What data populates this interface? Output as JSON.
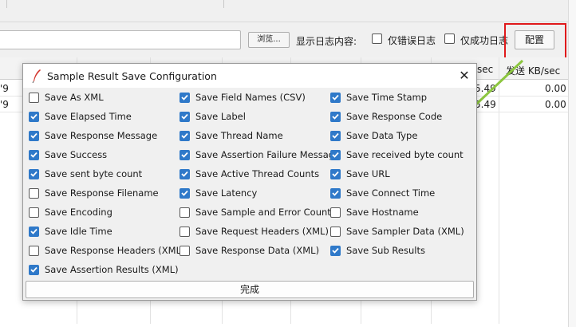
{
  "toolbar": {
    "browse_label": "浏览...",
    "log_content_label": "显示日志内容:",
    "errors_only_label": "仅错误日志",
    "errors_only_checked": false,
    "success_only_label": "仅成功日志",
    "success_only_checked": false,
    "config_label": "配置"
  },
  "table": {
    "header_sec": "sec",
    "header_sent": "发送 KB/sec",
    "rows": [
      {
        "first": "'9",
        "rate": "5.49",
        "sent": "0.00"
      },
      {
        "first": "'9",
        "rate": "5.49",
        "sent": "0.00"
      }
    ]
  },
  "dialog": {
    "title": "Sample Result Save Configuration",
    "icon": "feather-icon",
    "close_icon": "close-icon",
    "done_label": "完成",
    "columns": [
      [
        {
          "label": "Save As XML",
          "checked": false
        },
        {
          "label": "Save Elapsed Time",
          "checked": true
        },
        {
          "label": "Save Response Message",
          "checked": true
        },
        {
          "label": "Save Success",
          "checked": true
        },
        {
          "label": "Save sent byte count",
          "checked": true
        },
        {
          "label": "Save Response Filename",
          "checked": false
        },
        {
          "label": "Save Encoding",
          "checked": false
        },
        {
          "label": "Save Idle Time",
          "checked": true
        },
        {
          "label": "Save Response Headers (XML)",
          "checked": false
        },
        {
          "label": "Save Assertion Results (XML)",
          "checked": true
        }
      ],
      [
        {
          "label": "Save Field Names (CSV)",
          "checked": true
        },
        {
          "label": "Save Label",
          "checked": true
        },
        {
          "label": "Save Thread Name",
          "checked": true
        },
        {
          "label": "Save Assertion Failure Message",
          "checked": true
        },
        {
          "label": "Save Active Thread Counts",
          "checked": true
        },
        {
          "label": "Save Latency",
          "checked": true
        },
        {
          "label": "Save Sample and Error Counts",
          "checked": false
        },
        {
          "label": "Save Request Headers (XML)",
          "checked": false
        },
        {
          "label": "Save Response Data (XML)",
          "checked": false
        }
      ],
      [
        {
          "label": "Save Time Stamp",
          "checked": true
        },
        {
          "label": "Save Response Code",
          "checked": true
        },
        {
          "label": "Save Data Type",
          "checked": true
        },
        {
          "label": "Save received byte count",
          "checked": true
        },
        {
          "label": "Save URL",
          "checked": true
        },
        {
          "label": "Save Connect Time",
          "checked": true
        },
        {
          "label": "Save Hostname",
          "checked": false
        },
        {
          "label": "Save Sampler Data (XML)",
          "checked": false
        },
        {
          "label": "Save Sub Results",
          "checked": true
        }
      ]
    ]
  },
  "colors": {
    "checkbox_checked": "#2f79c9",
    "highlight_box": "#e0191b",
    "annotation_arrow": "#8cc63f"
  }
}
